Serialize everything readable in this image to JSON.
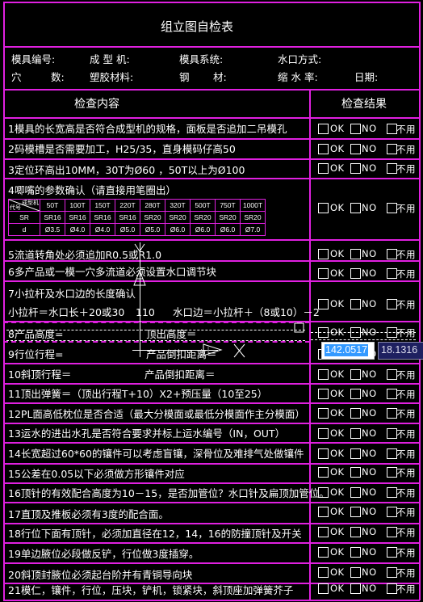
{
  "title": "组立图自检表",
  "info": {
    "row1": [
      "模具编号:",
      "成 型 机:",
      "模具系统:",
      "水口方式:"
    ],
    "row2": [
      "穴",
      "数:",
      "塑胶材料:",
      "钢",
      "材:",
      "缩 水 率:",
      "日期:"
    ]
  },
  "table_header": {
    "content": "检查内容",
    "result": "检查结果"
  },
  "result_options": {
    "ok": "OK",
    "no": "NO",
    "na": "不用"
  },
  "items": [
    "1模具的长宽高是否符合成型机的规格，面板是否追加二吊模孔",
    "2码模槽是否需要加工，H25/35，直身模码仔高50",
    "3定位环高出10MM，30T为Ø60      ，50T以上为Ø100",
    "4唧嘴的参数确认（请直接用笔圈出）",
    "5流道转角处必须追加R0.5或R1.0",
    "6多产品或一模一穴多流道必须设置水口调节块",
    "7小拉杆及水口边的长度确认",
    "8产品高度=",
    "9行位行程=",
    "10斜顶行程＝",
    "11顶出弹簧＝（顶出行程T+10）X2+预压量（10至25）",
    "12PL面高低枕位是否合适（最大分模面或最低分模面作主分模面）",
    "13运水的进出水孔是否符合要求并标上运水编号（IN，OUT）",
    "14长宽超过60*60的镶件可以考虑盲镶，深骨位及难排气处做镶件",
    "15公差在0.05以下必须做方形镶件对应",
    "16顶针的有效配合高度为10－15，是否加管位？水口针及扁顶加管位。",
    "17直顶及推板必须有3度的配合面。",
    "18行位下面有顶针，必须加直径在12，14，16的防撞顶针及开关",
    "19单边腋位必段做反铲，行位做3度插穿。",
    "20斜顶封腋位必须起台阶并有青铜导向块",
    "21模仁，镶件，行位，压块，铲机，锁紧块，斜顶座加弹簧芥子"
  ],
  "item7_formula": {
    "left": "小拉杆＝水口长＋20或30",
    "mid": "110",
    "right": "水口边＝小拉杆＋（8或10）－2"
  },
  "item8_right": "顶出高度＝",
  "item9_right": "产品倒扣距离＝",
  "item10_right": "产品倒扣距离＝",
  "nozzle_table": {
    "corner_top": "成型机",
    "corner_bottom": "代号",
    "columns": [
      "50T",
      "100T",
      "150T",
      "220T",
      "280T",
      "320T",
      "500T",
      "750T",
      "1000T"
    ],
    "rows": [
      {
        "label": "SR",
        "values": [
          "SR16",
          "SR16",
          "SR16",
          "SR16",
          "SR20",
          "SR20",
          "SR20",
          "SR20",
          "SR20"
        ]
      },
      {
        "label": "d",
        "values": [
          "Ø3.5",
          "Ø4.0",
          "Ø4.0",
          "Ø5.0",
          "Ø5.0",
          "Ø6.0",
          "Ø6.0",
          "Ø6.0",
          "Ø7.0"
        ]
      }
    ]
  },
  "dynamic_input": {
    "value": "142.0517",
    "coord": "18.1316"
  },
  "colors": {
    "grid": "#e020e0",
    "background": "#000000",
    "text": "#ffffff",
    "input_highlight": "#3399ff",
    "coord_bg": "#1e2060"
  }
}
